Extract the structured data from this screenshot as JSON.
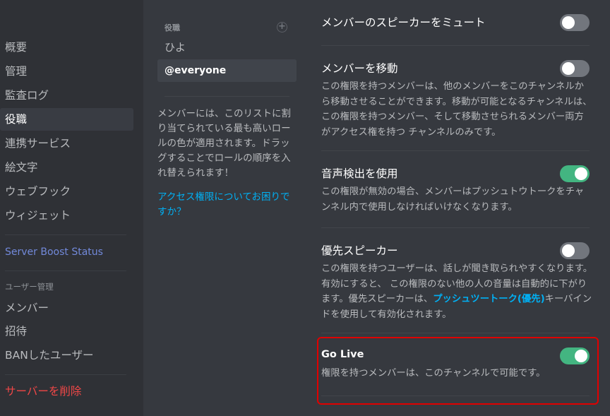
{
  "sidebar": {
    "items": [
      {
        "label": "概要"
      },
      {
        "label": "管理"
      },
      {
        "label": "監査ログ"
      },
      {
        "label": "役職",
        "selected": true
      },
      {
        "label": "連携サービス"
      },
      {
        "label": "絵文字"
      },
      {
        "label": "ウェブフック"
      },
      {
        "label": "ウィジェット"
      }
    ],
    "boost_label": "Server Boost Status",
    "user_section_header": "ユーザー管理",
    "user_items": [
      {
        "label": "メンバー"
      },
      {
        "label": "招待"
      },
      {
        "label": "BANしたユーザー"
      }
    ],
    "delete_label": "サーバーを削除"
  },
  "roles": {
    "header": "役職",
    "add_icon": "plus-circle-icon",
    "items": [
      {
        "label": "ひよ"
      },
      {
        "label": "@everyone",
        "selected": true
      }
    ],
    "help_text": "メンバーには、このリストに割り当てられている最も高いロールの色が適用されます。ドラッグすることでロールの順序を入れ替えられます！",
    "help_link": "アクセス権限についてお困りですか？"
  },
  "permissions": [
    {
      "title": "メンバーのスピーカーをミュート",
      "enabled": false
    },
    {
      "title": "メンバーを移動",
      "description": "この権限を持つメンバーは、他のメンバーをこのチャンネルから移動させることができます。移動が可能となるチャンネルは、この権限を持つメンバー、そして移動させられるメンバー両方がアクセス権を持つ チャンネルのみです。",
      "enabled": false
    },
    {
      "title": "音声検出を使用",
      "description": "この権限が無効の場合、メンバーはプッシュトウトークをチャンネル内で使用しなければいけなくなります。",
      "enabled": true
    },
    {
      "title": "優先スピーカー",
      "description_before": "この権限を持つユーザーは、話しが聞き取られやすくなります。有効にすると、 この権限のない他の人の音量は自動的に下がります。優先スピーカーは、",
      "description_link": "プッシュツートーク(優先)",
      "description_after": "キーバインドを使用して有効化されます。",
      "enabled": false
    },
    {
      "title": "Go Live",
      "description": "権限を持つメンバーは、このチャンネルで可能です。",
      "enabled": true,
      "highlighted": true
    }
  ],
  "colors": {
    "toggle_on": "#43b581",
    "toggle_off": "#72767d",
    "link": "#00b0f4",
    "boost": "#7289da",
    "danger": "#f04747",
    "highlight_border": "#e00000"
  }
}
